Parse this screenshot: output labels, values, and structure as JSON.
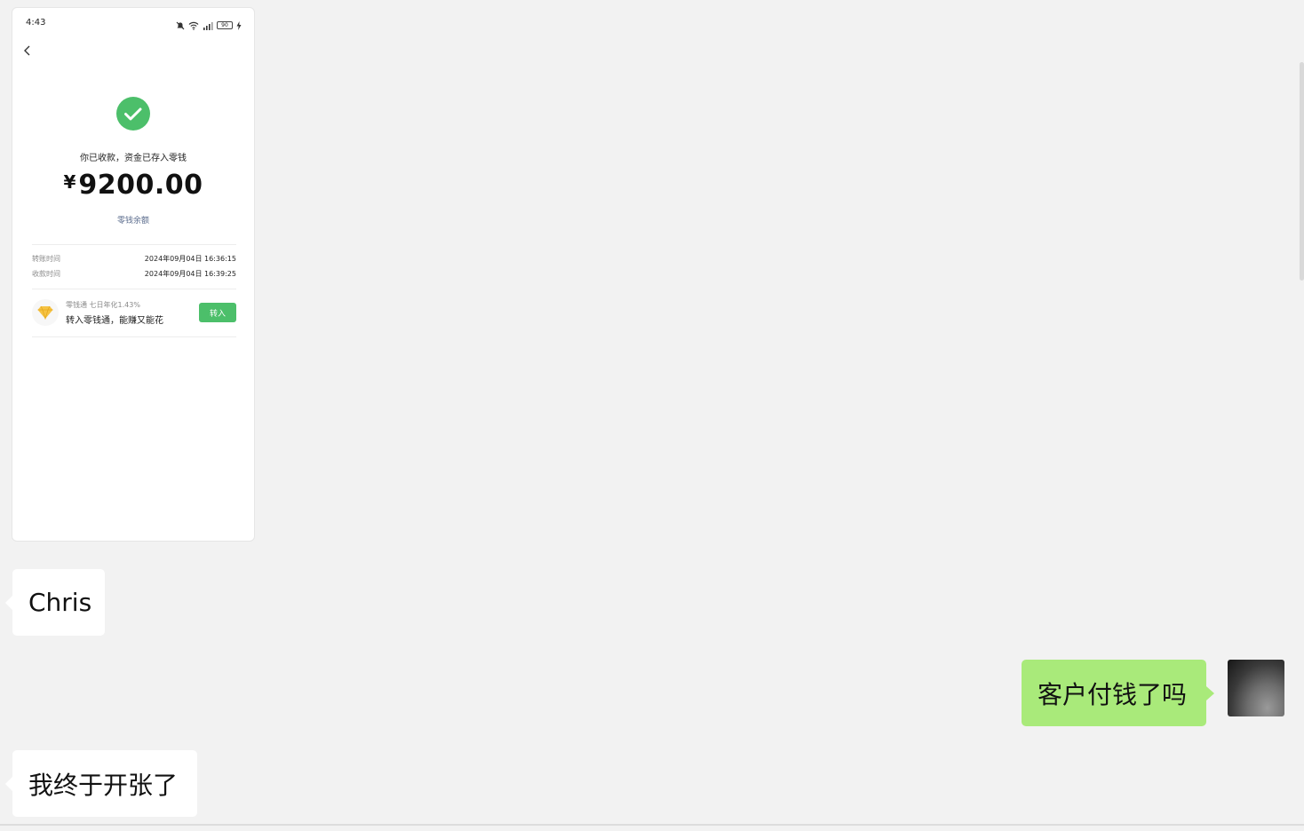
{
  "screenshot": {
    "status_time": "4:43",
    "battery_level": "90",
    "received_text": "你已收款，资金已存入零钱",
    "currency_symbol": "¥",
    "amount": "9200.00",
    "balance_link": "零钱余额",
    "rows": [
      {
        "label": "转账时间",
        "value": "2024年09月04日 16:36:15"
      },
      {
        "label": "收款时间",
        "value": "2024年09月04日 16:39:25"
      }
    ],
    "lqt": {
      "subtitle": "零钱通 七日年化1.43%",
      "title": "转入零钱通，能赚又能花",
      "button": "转入"
    }
  },
  "messages": [
    {
      "side": "left",
      "text": "Chris"
    },
    {
      "side": "right",
      "text": "客户付钱了吗"
    },
    {
      "side": "left",
      "text": "我终于开张了"
    }
  ],
  "colors": {
    "success_green": "#4cbf6a",
    "self_bubble": "#a9ea7a",
    "chat_background": "#f2f2f2"
  },
  "icons": {
    "status": [
      "mute-icon",
      "wifi-icon",
      "signal-icon",
      "battery-icon",
      "charging-icon"
    ],
    "success": "check-circle-icon",
    "lqt": "diamond-icon"
  }
}
